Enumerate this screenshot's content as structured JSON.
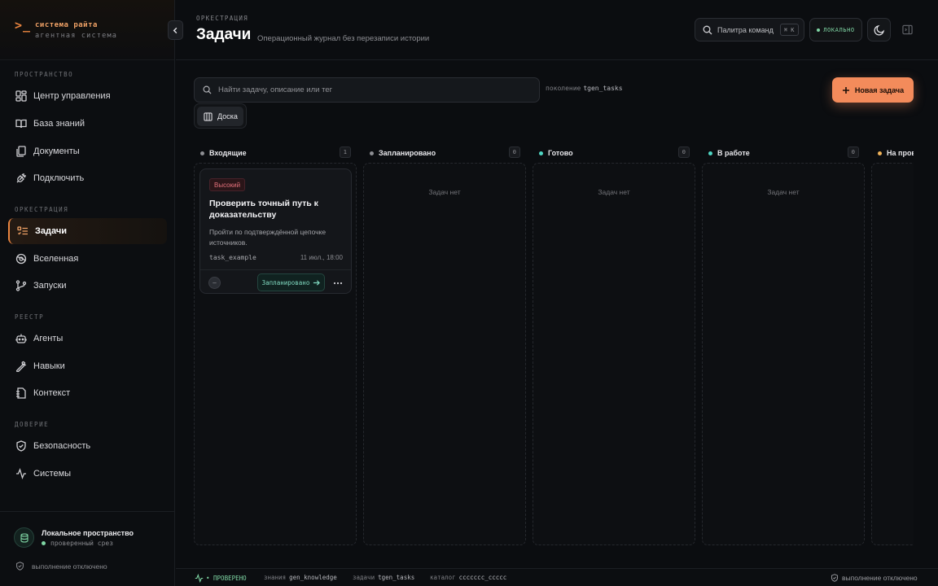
{
  "brand": {
    "logo": ">_",
    "title": "система райта",
    "subtitle": "агентная система"
  },
  "sidebar": {
    "sections": [
      {
        "label": "ПРОСТРАНСТВО"
      },
      {
        "label": "ОРКЕСТРАЦИЯ"
      },
      {
        "label": "РЕЕСТР"
      },
      {
        "label": "ДОВЕРИЕ"
      }
    ],
    "items": [
      {
        "label": "Центр управления",
        "icon": "dashboard-icon"
      },
      {
        "label": "База знаний",
        "icon": "book-icon"
      },
      {
        "label": "Документы",
        "icon": "documents-icon"
      },
      {
        "label": "Подключить",
        "icon": "plug-icon"
      },
      {
        "label": "Задачи",
        "icon": "tasks-icon",
        "active": true
      },
      {
        "label": "Вселенная",
        "icon": "universe-icon"
      },
      {
        "label": "Запуски",
        "icon": "branch-icon"
      },
      {
        "label": "Агенты",
        "icon": "bot-icon"
      },
      {
        "label": "Навыки",
        "icon": "wrench-icon"
      },
      {
        "label": "Контекст",
        "icon": "context-icon"
      },
      {
        "label": "Безопасность",
        "icon": "shield-icon"
      },
      {
        "label": "Системы",
        "icon": "activity-icon"
      }
    ],
    "workspace": {
      "name": "Локальное пространство",
      "status": "проверенный срез",
      "execution": "выполнение отключено"
    }
  },
  "header": {
    "crumb": "ОРКЕСТРАЦИЯ",
    "title": "Задачи",
    "subtitle": "Операционный журнал без перезаписи истории",
    "command_palette": "Палитра команд",
    "shortcut": "⌘ K",
    "local_badge": "ЛОКАЛЬНО"
  },
  "toolbar": {
    "search_placeholder": "Найти задачу, описание или тег",
    "generation_label": "поколение",
    "generation_value": "tgen_tasks",
    "new_task": "Новая задача",
    "view_board": "Доска"
  },
  "columns": [
    {
      "title": "Входящие",
      "count": "1",
      "dot": "#8d8e93",
      "empty": ""
    },
    {
      "title": "Запланировано",
      "count": "0",
      "dot": "#8d8e93",
      "empty": "Задач нет"
    },
    {
      "title": "Готово",
      "count": "0",
      "dot": "#4fd6c3",
      "empty": "Задач нет"
    },
    {
      "title": "В работе",
      "count": "0",
      "dot": "#4fd6c3",
      "empty": "Задач нет"
    },
    {
      "title": "На прове",
      "count": "",
      "dot": "#f0b35a",
      "empty": ""
    }
  ],
  "card": {
    "priority": "Высокий",
    "title": "Проверить точный путь к доказательству",
    "description": "Пройти по подтверждённой цепочке источников.",
    "tag": "task_example",
    "date": "11 июл., 18:00",
    "avatar": "–",
    "move_label": "Запланировано"
  },
  "statusbar": {
    "verified": "• ПРОВЕРЕНО",
    "knowledge_label": "знания",
    "knowledge_value": "gen_knowledge",
    "tasks_label": "задачи",
    "tasks_value": "tgen_tasks",
    "catalog_label": "каталог",
    "catalog_value": "ccccccc_ccccc",
    "execution": "выполнение отключено"
  },
  "colors": {
    "accent": "#f38b5b",
    "success": "#7fd6a4",
    "teal": "#4fd6c3",
    "danger": "#e2707a"
  }
}
